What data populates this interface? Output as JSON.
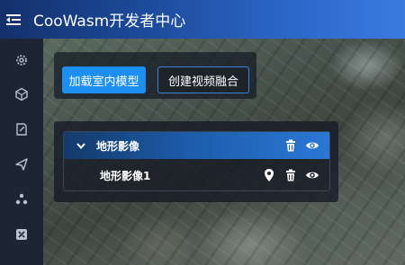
{
  "header": {
    "title": "CooWasm开发者中心",
    "menu_icon": "menu-fold-icon"
  },
  "sidebar": {
    "items": [
      {
        "icon": "settings-icon"
      },
      {
        "icon": "cube-icon"
      },
      {
        "icon": "edit-icon"
      },
      {
        "icon": "send-icon"
      },
      {
        "icon": "cluster-icon"
      },
      {
        "icon": "tools-icon"
      }
    ]
  },
  "toolbar": {
    "load_indoor_label": "加载室内模型",
    "create_video_label": "创建视频融合"
  },
  "tree": {
    "parent": {
      "label": "地形影像",
      "expanded": true
    },
    "children": [
      {
        "label": "地形影像1"
      }
    ]
  },
  "colors": {
    "primary": "#1d8ff0",
    "header_start": "#14306a",
    "header_end": "#3a7be0",
    "sidebar": "#1d2433"
  }
}
